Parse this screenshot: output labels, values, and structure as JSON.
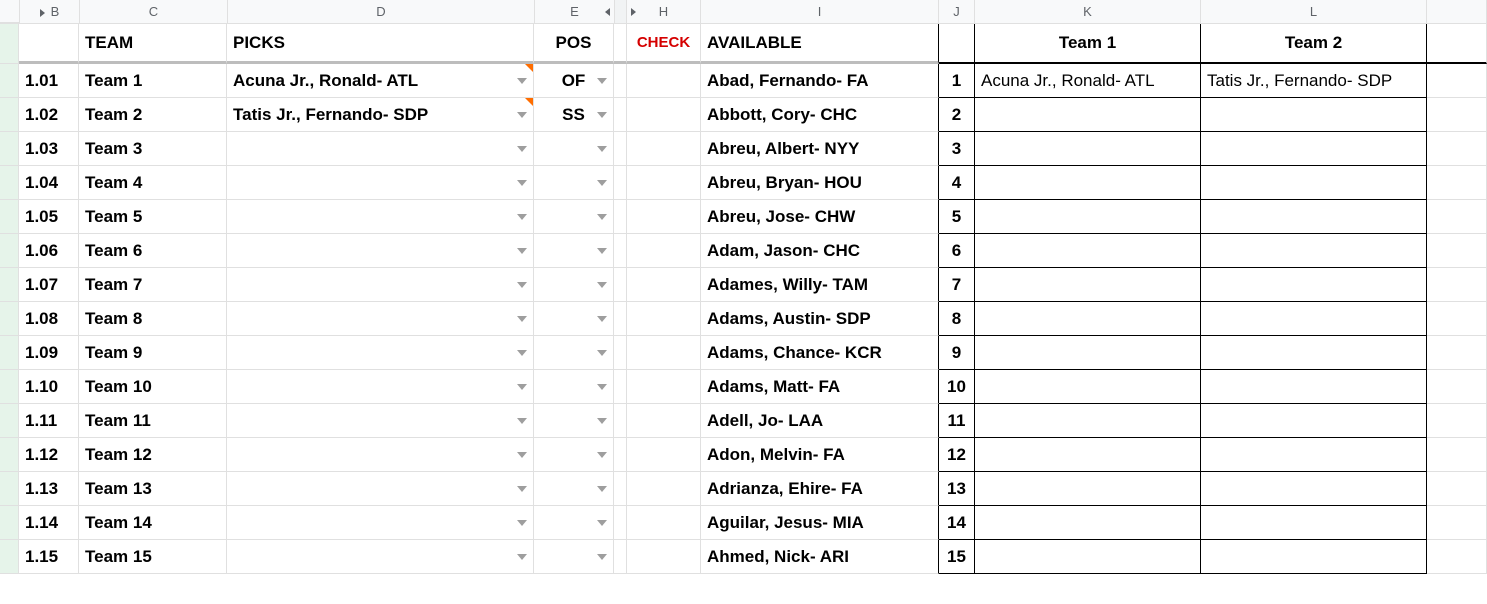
{
  "columns": {
    "B": "B",
    "C": "C",
    "D": "D",
    "E": "E",
    "H": "H",
    "I": "I",
    "J": "J",
    "K": "K",
    "L": "L"
  },
  "headers": {
    "team": "TEAM",
    "picks": "PICKS",
    "pos": "POS",
    "check": "CHECK",
    "available": "AVAILABLE",
    "col_k": "Team 1",
    "col_l": "Team 2"
  },
  "rows": [
    {
      "b": "1.01",
      "team": "Team 1",
      "pick": "Acuna Jr., Ronald- ATL",
      "pos": "OF",
      "avail": "Abad, Fernando- FA",
      "j": "1",
      "k": "Acuna Jr., Ronald- ATL",
      "l": "Tatis Jr., Fernando- SDP",
      "note": true
    },
    {
      "b": "1.02",
      "team": "Team 2",
      "pick": "Tatis Jr., Fernando- SDP",
      "pos": "SS",
      "avail": "Abbott, Cory- CHC",
      "j": "2",
      "k": "",
      "l": "",
      "note": true
    },
    {
      "b": "1.03",
      "team": "Team 3",
      "pick": "",
      "pos": "",
      "avail": "Abreu, Albert- NYY",
      "j": "3",
      "k": "",
      "l": ""
    },
    {
      "b": "1.04",
      "team": "Team 4",
      "pick": "",
      "pos": "",
      "avail": "Abreu, Bryan- HOU",
      "j": "4",
      "k": "",
      "l": ""
    },
    {
      "b": "1.05",
      "team": "Team 5",
      "pick": "",
      "pos": "",
      "avail": "Abreu, Jose- CHW",
      "j": "5",
      "k": "",
      "l": ""
    },
    {
      "b": "1.06",
      "team": "Team 6",
      "pick": "",
      "pos": "",
      "avail": "Adam, Jason- CHC",
      "j": "6",
      "k": "",
      "l": ""
    },
    {
      "b": "1.07",
      "team": "Team 7",
      "pick": "",
      "pos": "",
      "avail": "Adames, Willy- TAM",
      "j": "7",
      "k": "",
      "l": ""
    },
    {
      "b": "1.08",
      "team": "Team 8",
      "pick": "",
      "pos": "",
      "avail": "Adams, Austin- SDP",
      "j": "8",
      "k": "",
      "l": ""
    },
    {
      "b": "1.09",
      "team": "Team 9",
      "pick": "",
      "pos": "",
      "avail": "Adams, Chance- KCR",
      "j": "9",
      "k": "",
      "l": ""
    },
    {
      "b": "1.10",
      "team": "Team 10",
      "pick": "",
      "pos": "",
      "avail": "Adams, Matt- FA",
      "j": "10",
      "k": "",
      "l": ""
    },
    {
      "b": "1.11",
      "team": "Team 11",
      "pick": "",
      "pos": "",
      "avail": "Adell, Jo- LAA",
      "j": "11",
      "k": "",
      "l": ""
    },
    {
      "b": "1.12",
      "team": "Team 12",
      "pick": "",
      "pos": "",
      "avail": "Adon, Melvin- FA",
      "j": "12",
      "k": "",
      "l": ""
    },
    {
      "b": "1.13",
      "team": "Team 13",
      "pick": "",
      "pos": "",
      "avail": "Adrianza, Ehire- FA",
      "j": "13",
      "k": "",
      "l": ""
    },
    {
      "b": "1.14",
      "team": "Team 14",
      "pick": "",
      "pos": "",
      "avail": "Aguilar, Jesus- MIA",
      "j": "14",
      "k": "",
      "l": ""
    },
    {
      "b": "1.15",
      "team": "Team 15",
      "pick": "",
      "pos": "",
      "avail": "Ahmed, Nick- ARI",
      "j": "15",
      "k": "",
      "l": ""
    }
  ]
}
